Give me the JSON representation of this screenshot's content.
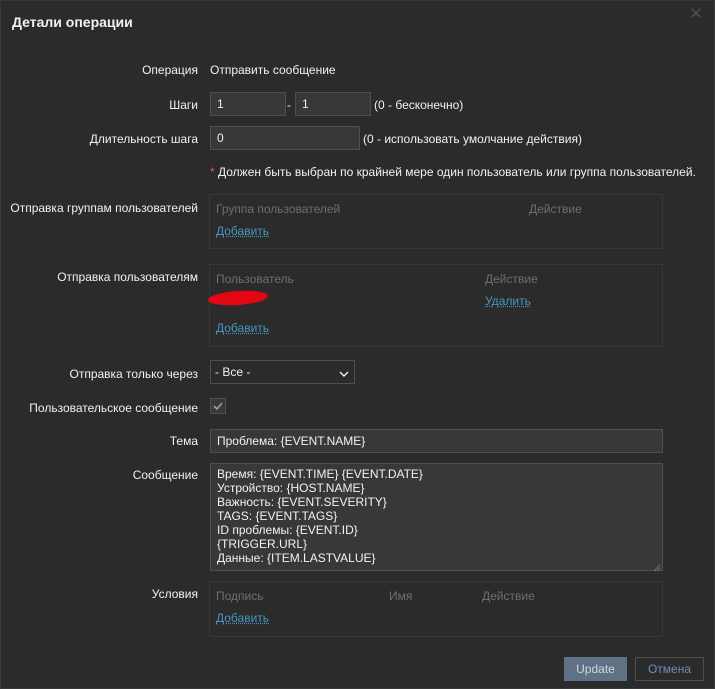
{
  "dialog": {
    "title": "Детали операции",
    "close_icon": "close-icon"
  },
  "operation": {
    "label": "Операция",
    "value": "Отправить сообщение"
  },
  "steps": {
    "label": "Шаги",
    "from": "1",
    "to": "1",
    "separator": "-",
    "hint": "(0 - бесконечно)"
  },
  "step_duration": {
    "label": "Длительность шага",
    "value": "0",
    "hint": "(0 - использовать умолчание действия)"
  },
  "requirement": {
    "star": "*",
    "text": " Должен быть выбран по крайней мере один пользователь или группа пользователей."
  },
  "user_groups": {
    "label": "Отправка группам пользователей",
    "col_group": "Группа пользователей",
    "col_action": "Действие",
    "add_link": "Добавить"
  },
  "users": {
    "label": "Отправка пользователям",
    "col_user": "Пользователь",
    "col_action": "Действие",
    "remove_link": "Удалить",
    "add_link": "Добавить"
  },
  "send_only_via": {
    "label": "Отправка только через",
    "selected": "- Все -"
  },
  "custom_message": {
    "label": "Пользовательское сообщение",
    "checked": true
  },
  "subject": {
    "label": "Тема",
    "value": "Проблема: {EVENT.NAME}"
  },
  "message": {
    "label": "Сообщение",
    "value": "Время: {EVENT.TIME} {EVENT.DATE}\nУстройство: {HOST.NAME}\nВажность: {EVENT.SEVERITY}\nTAGS: {EVENT.TAGS}\nID проблемы: {EVENT.ID}\n{TRIGGER.URL}\nДанные: {ITEM.LASTVALUE}"
  },
  "conditions": {
    "label": "Условия",
    "col_label": "Подпись",
    "col_name": "Имя",
    "col_action": "Действие",
    "add_link": "Добавить"
  },
  "footer": {
    "update_label": "Update",
    "cancel_label": "Отмена"
  },
  "colors": {
    "background": "#2b2b2b",
    "field": "#383838",
    "link": "#4796c4",
    "required": "#e45959",
    "primary_button": "#687e96"
  }
}
